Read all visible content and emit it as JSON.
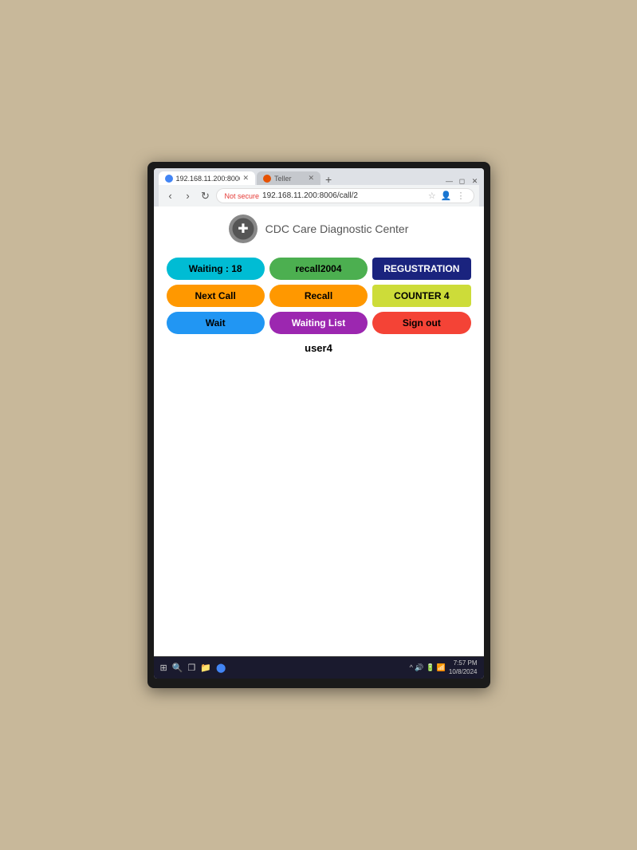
{
  "browser": {
    "tab1_label": "192.168.11.200:8006/call/2",
    "tab2_label": "Teller",
    "address": "192.168.11.200:8006/call/2",
    "not_secure_label": "Not secure",
    "window_title": "192.168.11.200:8006/call/2"
  },
  "site": {
    "title": "CDC Care Diagnostic Center",
    "logo_alt": "CDC Logo"
  },
  "buttons": {
    "waiting_label": "Waiting : 18",
    "recall2004_label": "recall2004",
    "registration_label": "REGUSTRATION",
    "next_call_label": "Next Call",
    "recall_label": "Recall",
    "counter4_label": "COUNTER 4",
    "wait_label": "Wait",
    "waiting_list_label": "Waiting List",
    "sign_out_label": "Sign out"
  },
  "user": {
    "username": "user4"
  },
  "taskbar": {
    "time": "7:57 PM",
    "date": "10/8/2024"
  }
}
